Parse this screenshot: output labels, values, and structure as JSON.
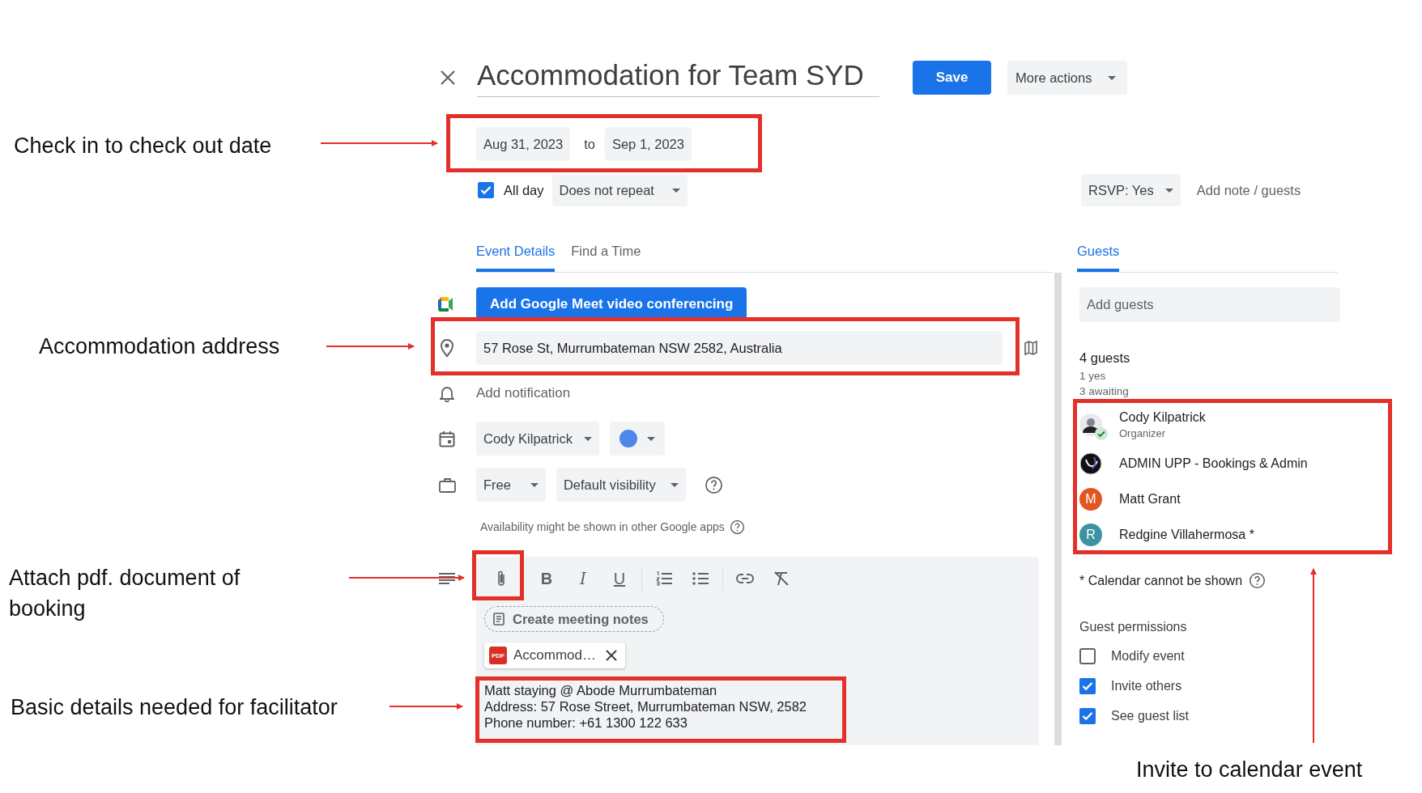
{
  "header": {
    "title": "Accommodation for Team SYD",
    "save": "Save",
    "more_actions": "More actions"
  },
  "dates": {
    "start": "Aug 31, 2023",
    "separator": "to",
    "end": "Sep 1, 2023"
  },
  "all_day": {
    "label": "All day",
    "checked": true
  },
  "repeat": "Does not repeat",
  "rsvp": {
    "label": "RSVP: Yes",
    "note_link": "Add note / guests"
  },
  "tabs": [
    {
      "label": "Event Details",
      "selected": true
    },
    {
      "label": "Find a Time",
      "selected": false
    }
  ],
  "conference_button": "Add Google Meet video conferencing",
  "location": {
    "value": "57 Rose St, Murrumbateman NSW 2582, Australia"
  },
  "notification": "Add notification",
  "calendar_owner": "Cody Kilpatrick",
  "availability": {
    "status": "Free",
    "visibility": "Default visibility",
    "note": "Availability might be shown in other Google apps"
  },
  "description": {
    "format_buttons": [
      "B",
      "I",
      "U"
    ],
    "meeting_notes": "Create meeting notes",
    "attachment": {
      "badge": "PDF",
      "name": "Accommod…"
    },
    "lines": [
      "Matt staying @ Abode Murrumbateman",
      "Address: 57 Rose Street, Murrumbateman NSW, 2582",
      "Phone number: +61 1300 122 633"
    ]
  },
  "guests_panel": {
    "tabs": [
      {
        "label": "Guests",
        "selected": true
      }
    ],
    "add_placeholder": "Add guests",
    "count": "4 guests",
    "yes": "1 yes",
    "awaiting": "3 awaiting",
    "guests": [
      {
        "name": "Cody Kilpatrick",
        "role": "Organizer",
        "kind": "photo",
        "accepted": true
      },
      {
        "name": "ADMIN UPP - Bookings & Admin",
        "kind": "logo",
        "accepted": false
      },
      {
        "name": "Matt Grant",
        "kind": "initial",
        "initial": "M",
        "color": "#e2571f",
        "accepted": false
      },
      {
        "name": "Redgine Villahermosa *",
        "kind": "initial",
        "initial": "R",
        "color": "#3c93a2",
        "accepted": false
      }
    ],
    "footnote": "* Calendar cannot be shown",
    "permissions_title": "Guest permissions",
    "permissions": [
      {
        "label": "Modify event",
        "checked": false
      },
      {
        "label": "Invite others",
        "checked": true
      },
      {
        "label": "See guest list",
        "checked": true
      }
    ]
  },
  "annotations": [
    {
      "text": "Check in to check out date"
    },
    {
      "text": "Accommodation address"
    },
    {
      "text": "Attach pdf. document of booking"
    },
    {
      "text": "Basic details needed for facilitator"
    },
    {
      "text": "Invite to calendar event"
    }
  ]
}
